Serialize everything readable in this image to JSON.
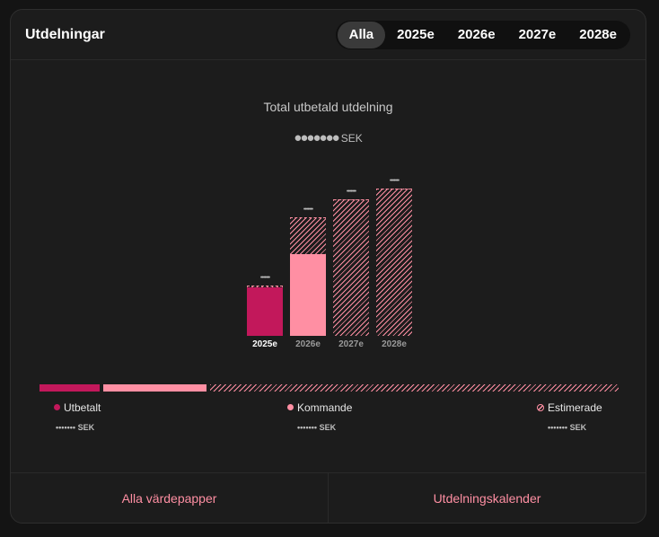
{
  "header": {
    "title": "Utdelningar"
  },
  "tabs": [
    {
      "label": "Alla",
      "active": true
    },
    {
      "label": "2025e",
      "active": false
    },
    {
      "label": "2026e",
      "active": false
    },
    {
      "label": "2027e",
      "active": false
    },
    {
      "label": "2028e",
      "active": false
    }
  ],
  "summary": {
    "label": "Total utbetald utdelning",
    "value_masked": "●●●●●●●",
    "unit": "SEK"
  },
  "chart_data": {
    "type": "bar",
    "stacked": true,
    "categories": [
      "2025e",
      "2026e",
      "2027e",
      "2028e"
    ],
    "active_category": "2025e",
    "value_labels": [
      "•••••••",
      "•••••••",
      "•••••••",
      "•••••••"
    ],
    "series": [
      {
        "name": "Utbetalt",
        "color": "#c2185b",
        "values": [
          52,
          0,
          0,
          0
        ]
      },
      {
        "name": "Kommande",
        "color": "#ff8fa3",
        "values": [
          0,
          88,
          0,
          0
        ]
      },
      {
        "name": "Estimerade",
        "color": "#ff8fa3",
        "values": [
          2,
          40,
          148,
          159
        ]
      }
    ],
    "ylim": [
      0,
      170
    ]
  },
  "breakdown": {
    "paid_fraction": 0.105,
    "upcoming_fraction": 0.18,
    "estimated_fraction": 0.715
  },
  "legend": [
    {
      "label": "Utbetalt",
      "value_masked": "•••••••",
      "unit": "SEK",
      "color": "#c2185b"
    },
    {
      "label": "Kommande",
      "value_masked": "•••••••",
      "unit": "SEK",
      "color": "#ff8fa3"
    },
    {
      "label": "Estimerade",
      "value_masked": "•••••••",
      "unit": "SEK",
      "color": "#ff8fa3"
    }
  ],
  "footer": {
    "left_label": "Alla värdepapper",
    "right_label": "Utdelningskalender"
  }
}
